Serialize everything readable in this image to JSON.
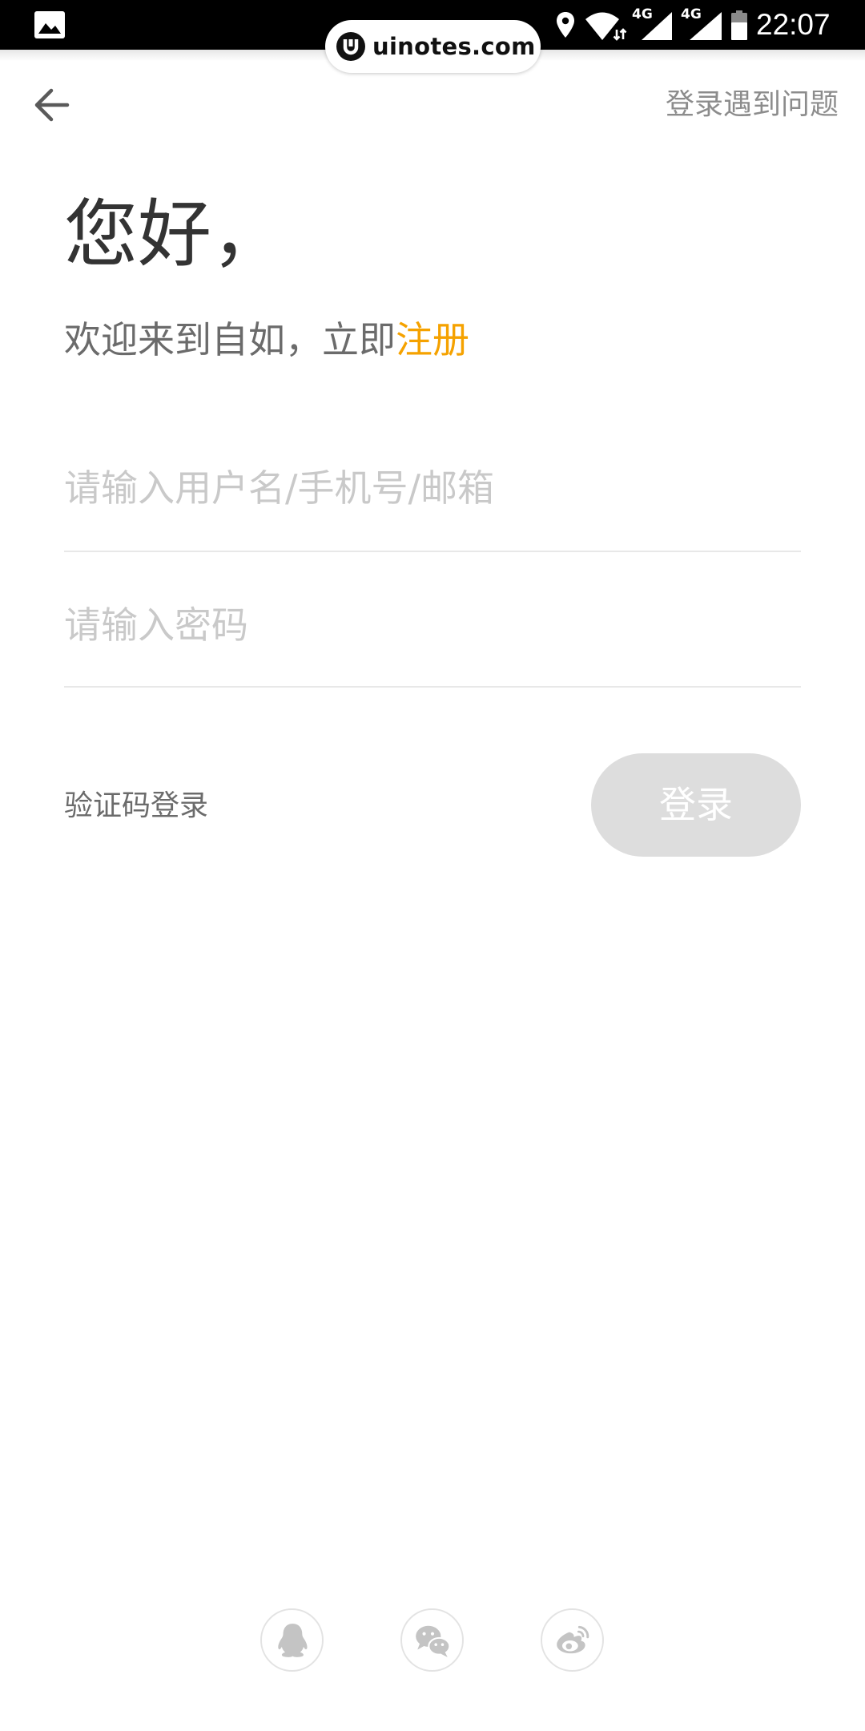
{
  "status_bar": {
    "time": "22:07",
    "network_labels": [
      "4G",
      "4G"
    ],
    "icons": [
      "gallery-icon",
      "location-icon",
      "wifi-icon",
      "cell-signal-icon",
      "cell-signal-icon",
      "battery-icon"
    ]
  },
  "watermark": {
    "text": "uinotes.com",
    "icon": "uinotes-logo-icon"
  },
  "header": {
    "back_icon": "back-arrow-icon",
    "help_label": "登录遇到问题"
  },
  "greeting": {
    "title": "您好，",
    "subtitle_prefix": "欢迎来到自如，立即",
    "register_link": "注册"
  },
  "form": {
    "username": {
      "placeholder": "请输入用户名/手机号/邮箱",
      "value": ""
    },
    "password": {
      "placeholder": "请输入密码",
      "value": ""
    },
    "sms_login_label": "验证码登录",
    "login_button": {
      "label": "登录",
      "enabled": false
    }
  },
  "social_login": {
    "providers": [
      {
        "icon": "qq-icon"
      },
      {
        "icon": "wechat-icon"
      },
      {
        "icon": "weibo-icon"
      }
    ]
  },
  "colors": {
    "accent": "#f5a200",
    "title": "#333333",
    "subtitle": "#6b6b6b",
    "placeholder": "#c9c9c9",
    "button_disabled": "#dddddd",
    "status_bar": "#000000"
  }
}
